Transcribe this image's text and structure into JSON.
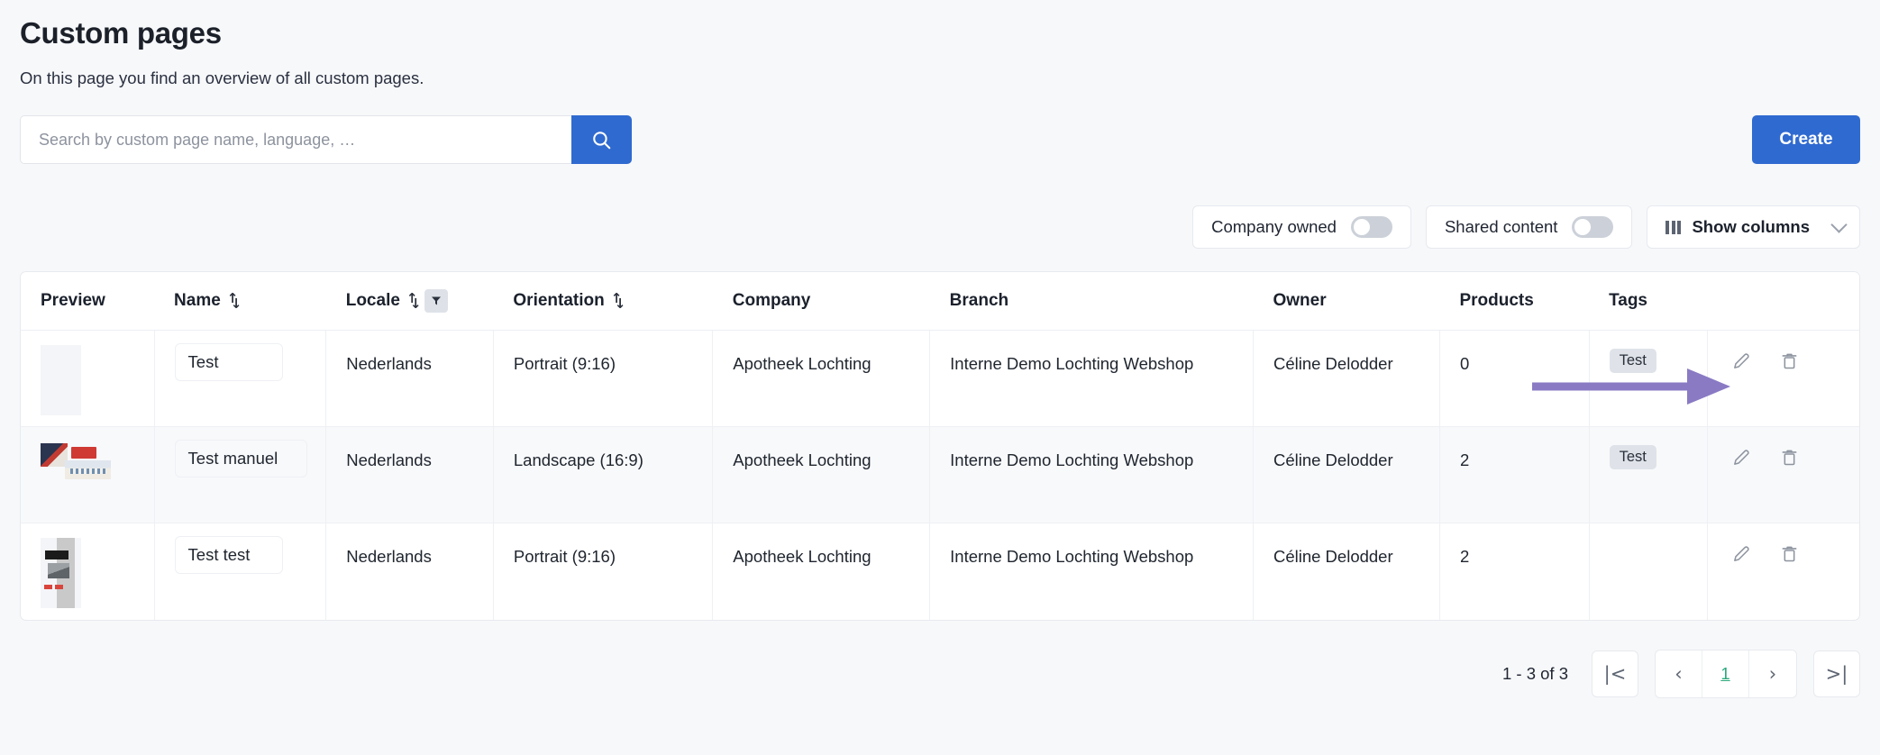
{
  "header": {
    "title": "Custom pages",
    "subtitle": "On this page you find an overview of all custom pages."
  },
  "search": {
    "placeholder": "Search by custom page name, language, …",
    "value": "",
    "icon": "search-icon"
  },
  "create_button": {
    "label": "Create"
  },
  "toolbar": {
    "company_owned": {
      "label": "Company owned",
      "state": "off"
    },
    "shared_content": {
      "label": "Shared content",
      "state": "off"
    },
    "show_columns": {
      "label": "Show columns",
      "icon": "columns-icon",
      "chevron": "chevron-down-icon"
    }
  },
  "table": {
    "columns": [
      {
        "label": "Preview",
        "sortable": false,
        "filter": false
      },
      {
        "label": "Name",
        "sortable": true,
        "filter": false
      },
      {
        "label": "Locale",
        "sortable": true,
        "filter": true
      },
      {
        "label": "Orientation",
        "sortable": true,
        "filter": false
      },
      {
        "label": "Company",
        "sortable": false,
        "filter": false
      },
      {
        "label": "Branch",
        "sortable": false,
        "filter": false
      },
      {
        "label": "Owner",
        "sortable": false,
        "filter": false
      },
      {
        "label": "Products",
        "sortable": false,
        "filter": false
      },
      {
        "label": "Tags",
        "sortable": false,
        "filter": false
      }
    ],
    "rows": [
      {
        "name": "Test",
        "locale": "Nederlands",
        "orientation": "Portrait (9:16)",
        "company": "Apotheek Lochting",
        "branch": "Interne Demo Lochting Webshop",
        "owner": "Céline Delodder",
        "products": "0",
        "tags": [
          "Test"
        ]
      },
      {
        "name": "Test manuel",
        "locale": "Nederlands",
        "orientation": "Landscape (16:9)",
        "company": "Apotheek Lochting",
        "branch": "Interne Demo Lochting Webshop",
        "owner": "Céline Delodder",
        "products": "2",
        "tags": [
          "Test"
        ]
      },
      {
        "name": "Test test",
        "locale": "Nederlands",
        "orientation": "Portrait (9:16)",
        "company": "Apotheek Lochting",
        "branch": "Interne Demo Lochting Webshop",
        "owner": "Céline Delodder",
        "products": "2",
        "tags": []
      }
    ],
    "row_actions": {
      "edit": "edit-pencil-icon",
      "delete": "trash-icon"
    }
  },
  "pagination": {
    "summary": "1 - 3 of 3",
    "first": "|<",
    "prev": "‹",
    "current_page": "1",
    "next": "›",
    "last": ">|"
  },
  "annotation": {
    "type": "arrow",
    "color": "#8a7ac4",
    "points_to": "edit-pencil-icon-row-1"
  },
  "colors": {
    "accent_blue": "#2f6ad0",
    "page_bg": "#f7f8fa",
    "tag_bg": "#dfe3e9",
    "pager_active": "#2aa97a",
    "annotation_purple": "#8a7ac4"
  }
}
